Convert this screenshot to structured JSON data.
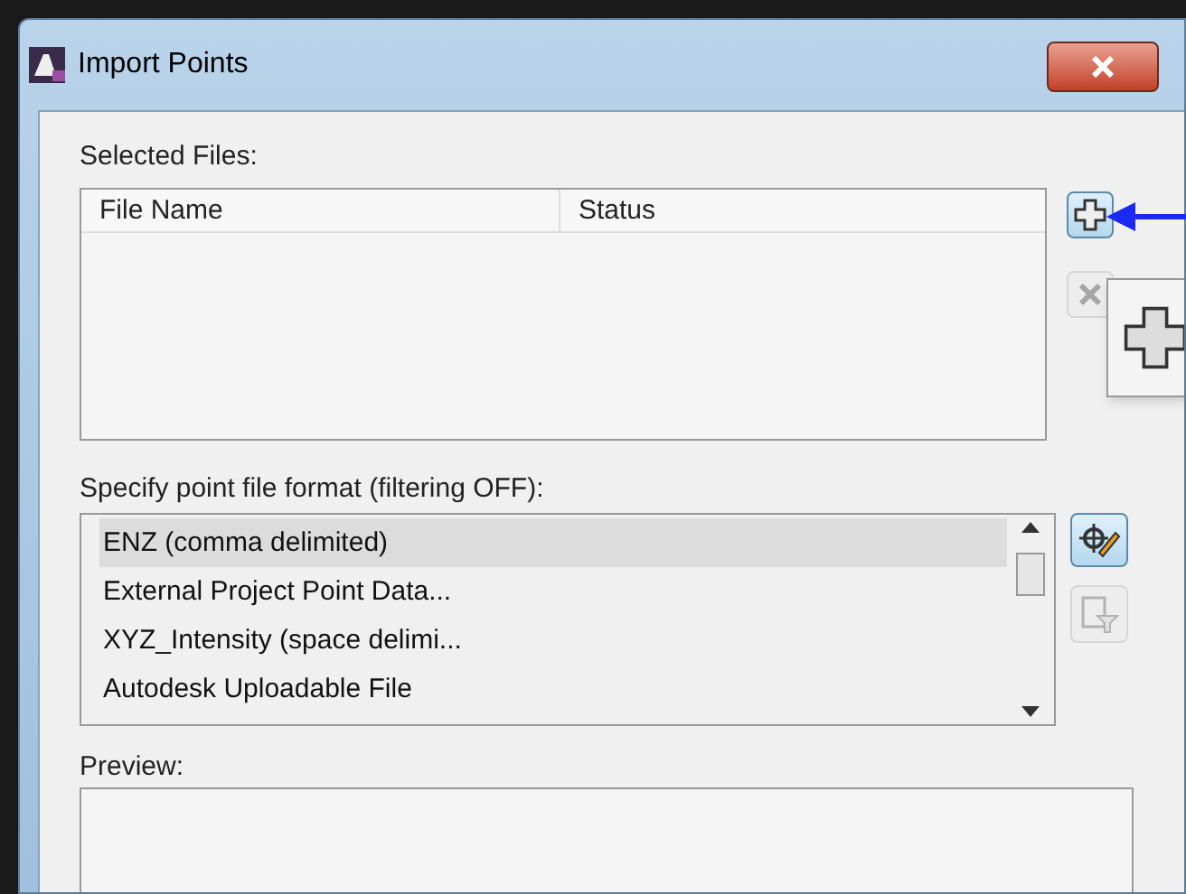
{
  "window": {
    "title": "Import Points"
  },
  "selected_files": {
    "label": "Selected Files:",
    "columns": [
      "File Name",
      "Status"
    ]
  },
  "add_button": {
    "disabled": false
  },
  "remove_button": {
    "disabled": true
  },
  "format": {
    "label": "Specify point file format (filtering OFF):",
    "items": [
      {
        "label": "ENZ (comma delimited)",
        "selected": true
      },
      {
        "label": "External Project Point Data...",
        "selected": false
      },
      {
        "label": "XYZ_Intensity (space delimi...",
        "selected": false
      },
      {
        "label": "Autodesk Uploadable File",
        "selected": false
      }
    ]
  },
  "edit_format_button": {
    "disabled": false
  },
  "filter_button": {
    "disabled": true
  },
  "preview": {
    "label": "Preview:"
  }
}
